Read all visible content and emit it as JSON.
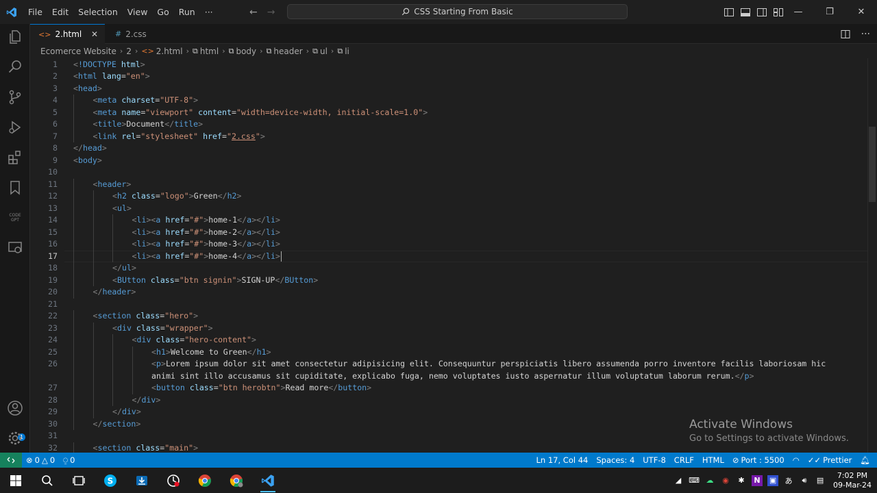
{
  "titlebar": {
    "menu": [
      "File",
      "Edit",
      "Selection",
      "View",
      "Go",
      "Run",
      "···"
    ],
    "search_text": "CSS Starting From Basic"
  },
  "tabs": [
    {
      "label": "2.html",
      "icon": "html-file-icon",
      "active": true
    },
    {
      "label": "2.css",
      "icon": "css-file-icon",
      "active": false
    }
  ],
  "breadcrumb": [
    "Ecomerce Website",
    "2",
    "2.html",
    "html",
    "body",
    "header",
    "ul",
    "li"
  ],
  "editor": {
    "lines": [
      {
        "n": "1",
        "indent": 0,
        "html": "<span class='t'>&lt;</span><span class='doct'>!DOCTYPE</span> <span class='attr'>html</span><span class='t'>&gt;</span>"
      },
      {
        "n": "2",
        "indent": 0,
        "html": "<span class='t'>&lt;</span><span class='tag'>html</span> <span class='attr'>lang</span>=<span class='val'>\"en\"</span><span class='t'>&gt;</span>"
      },
      {
        "n": "3",
        "indent": 0,
        "html": "<span class='t'>&lt;</span><span class='tag'>head</span><span class='t'>&gt;</span>"
      },
      {
        "n": "4",
        "indent": 1,
        "html": "<span class='t'>&lt;</span><span class='tag'>meta</span> <span class='attr'>charset</span>=<span class='val'>\"UTF-8\"</span><span class='t'>&gt;</span>"
      },
      {
        "n": "5",
        "indent": 1,
        "html": "<span class='t'>&lt;</span><span class='tag'>meta</span> <span class='attr'>name</span>=<span class='val'>\"viewport\"</span> <span class='attr'>content</span>=<span class='val'>\"width=device-width, initial-scale=1.0\"</span><span class='t'>&gt;</span>"
      },
      {
        "n": "6",
        "indent": 1,
        "html": "<span class='t'>&lt;</span><span class='tag'>title</span><span class='t'>&gt;</span><span class='txt'>Document</span><span class='t'>&lt;/</span><span class='tag'>title</span><span class='t'>&gt;</span>"
      },
      {
        "n": "7",
        "indent": 1,
        "html": "<span class='t'>&lt;</span><span class='tag'>link</span> <span class='attr'>rel</span>=<span class='val'>\"stylesheet\"</span> <span class='attr'>href</span>=<span class='val'>\"</span><span class='link-val'>2.css</span><span class='val'>\"</span><span class='t'>&gt;</span>"
      },
      {
        "n": "8",
        "indent": 0,
        "html": "<span class='t'>&lt;/</span><span class='tag'>head</span><span class='t'>&gt;</span>"
      },
      {
        "n": "9",
        "indent": 0,
        "html": "<span class='t'>&lt;</span><span class='tag'>body</span><span class='t'>&gt;</span>"
      },
      {
        "n": "10",
        "indent": 0,
        "html": ""
      },
      {
        "n": "11",
        "indent": 1,
        "html": "<span class='t'>&lt;</span><span class='tag'>header</span><span class='t'>&gt;</span>"
      },
      {
        "n": "12",
        "indent": 2,
        "html": "<span class='t'>&lt;</span><span class='tag'>h2</span> <span class='attr'>class</span>=<span class='val'>\"logo\"</span><span class='t'>&gt;</span><span class='txt'>Green</span><span class='t'>&lt;/</span><span class='tag'>h2</span><span class='t'>&gt;</span>"
      },
      {
        "n": "13",
        "indent": 2,
        "html": "<span class='t'>&lt;</span><span class='tag'>ul</span><span class='t'>&gt;</span>"
      },
      {
        "n": "14",
        "indent": 3,
        "html": "<span class='t'>&lt;</span><span class='tag'>li</span><span class='t'>&gt;&lt;</span><span class='tag'>a</span> <span class='attr'>href</span>=<span class='val'>\"#\"</span><span class='t'>&gt;</span><span class='txt'>home-1</span><span class='t'>&lt;/</span><span class='tag'>a</span><span class='t'>&gt;&lt;/</span><span class='tag'>li</span><span class='t'>&gt;</span>"
      },
      {
        "n": "15",
        "indent": 3,
        "html": "<span class='t'>&lt;</span><span class='tag'>li</span><span class='t'>&gt;&lt;</span><span class='tag'>a</span> <span class='attr'>href</span>=<span class='val'>\"#\"</span><span class='t'>&gt;</span><span class='txt'>home-2</span><span class='t'>&lt;/</span><span class='tag'>a</span><span class='t'>&gt;&lt;/</span><span class='tag'>li</span><span class='t'>&gt;</span>"
      },
      {
        "n": "16",
        "indent": 3,
        "html": "<span class='t'>&lt;</span><span class='tag'>li</span><span class='t'>&gt;&lt;</span><span class='tag'>a</span> <span class='attr'>href</span>=<span class='val'>\"#\"</span><span class='t'>&gt;</span><span class='txt'>home-3</span><span class='t'>&lt;/</span><span class='tag'>a</span><span class='t'>&gt;&lt;/</span><span class='tag'>li</span><span class='t'>&gt;</span>"
      },
      {
        "n": "17",
        "indent": 3,
        "html": "<span class='t'>&lt;</span><span class='tag'>li</span><span class='t'>&gt;&lt;</span><span class='tag'>a</span> <span class='attr'>href</span>=<span class='val'>\"#\"</span><span class='t'>&gt;</span><span class='txt'>home-4</span><span class='t'>&lt;/</span><span class='tag'>a</span><span class='t'>&gt;&lt;/</span><span class='tag'>li</span><span class='t'>&gt;</span>"
      },
      {
        "n": "18",
        "indent": 2,
        "html": "<span class='t'>&lt;/</span><span class='tag'>ul</span><span class='t'>&gt;</span>"
      },
      {
        "n": "19",
        "indent": 2,
        "html": "<span class='t'>&lt;</span><span class='tag'>BUtton</span> <span class='attr'>class</span>=<span class='val'>\"btn signin\"</span><span class='t'>&gt;</span><span class='txt'>SIGN-UP</span><span class='t'>&lt;/</span><span class='tag'>BUtton</span><span class='t'>&gt;</span>"
      },
      {
        "n": "20",
        "indent": 1,
        "html": "<span class='t'>&lt;/</span><span class='tag'>header</span><span class='t'>&gt;</span>"
      },
      {
        "n": "21",
        "indent": 0,
        "html": ""
      },
      {
        "n": "22",
        "indent": 1,
        "html": "<span class='t'>&lt;</span><span class='tag'>section</span> <span class='attr'>class</span>=<span class='val'>\"hero\"</span><span class='t'>&gt;</span>"
      },
      {
        "n": "23",
        "indent": 2,
        "html": "<span class='t'>&lt;</span><span class='tag'>div</span> <span class='attr'>class</span>=<span class='val'>\"wrapper\"</span><span class='t'>&gt;</span>"
      },
      {
        "n": "24",
        "indent": 3,
        "html": "<span class='t'>&lt;</span><span class='tag'>div</span> <span class='attr'>class</span>=<span class='val'>\"hero-content\"</span><span class='t'>&gt;</span>"
      },
      {
        "n": "25",
        "indent": 4,
        "html": "<span class='t'>&lt;</span><span class='tag'>h1</span><span class='t'>&gt;</span><span class='txt'>Welcome to Green</span><span class='t'>&lt;/</span><span class='tag'>h1</span><span class='t'>&gt;</span>"
      },
      {
        "n": "26",
        "indent": 4,
        "html": "<span class='t'>&lt;</span><span class='tag'>p</span><span class='t'>&gt;</span><span class='txt'>Lorem ipsum dolor sit amet consectetur adipisicing elit. Consequuntur perspiciatis libero assumenda porro inventore facilis laboriosam hic</span>"
      },
      {
        "n": "",
        "indent": 4,
        "html": "<span class='txt'>animi sint illo accusamus sit cupiditate, explicabo fuga, nemo voluptates iusto aspernatur illum voluptatum laborum rerum.</span><span class='t'>&lt;/</span><span class='tag'>p</span><span class='t'>&gt;</span>"
      },
      {
        "n": "27",
        "indent": 4,
        "html": "<span class='t'>&lt;</span><span class='tag'>button</span> <span class='attr'>class</span>=<span class='val'>\"btn herobtn\"</span><span class='t'>&gt;</span><span class='txt'>Read more</span><span class='t'>&lt;/</span><span class='tag'>button</span><span class='t'>&gt;</span>"
      },
      {
        "n": "28",
        "indent": 3,
        "html": "<span class='t'>&lt;/</span><span class='tag'>div</span><span class='t'>&gt;</span>"
      },
      {
        "n": "29",
        "indent": 2,
        "html": "<span class='t'>&lt;/</span><span class='tag'>div</span><span class='t'>&gt;</span>"
      },
      {
        "n": "30",
        "indent": 1,
        "html": "<span class='t'>&lt;/</span><span class='tag'>section</span><span class='t'>&gt;</span>"
      },
      {
        "n": "31",
        "indent": 0,
        "html": ""
      },
      {
        "n": "32",
        "indent": 1,
        "html": "<span class='t'>&lt;</span><span class='tag'>section</span> <span class='attr'>class</span>=<span class='val'>\"main\"</span><span class='t'>&gt;</span>"
      }
    ],
    "active_line": "17"
  },
  "watermark": {
    "title": "Activate Windows",
    "subtitle": "Go to Settings to activate Windows."
  },
  "statusbar": {
    "errors": "0",
    "warnings": "0",
    "ports": "0",
    "position": "Ln 17, Col 44",
    "spaces": "Spaces: 4",
    "encoding": "UTF-8",
    "eol": "CRLF",
    "language": "HTML",
    "port": "Port : 5500",
    "formatter": "Prettier"
  },
  "taskbar": {
    "time": "7:02 PM",
    "date": "09-Mar-24"
  },
  "colors": {
    "accent": "#007acc",
    "remote": "#16825d",
    "tab_active_border": "#0078d4"
  }
}
